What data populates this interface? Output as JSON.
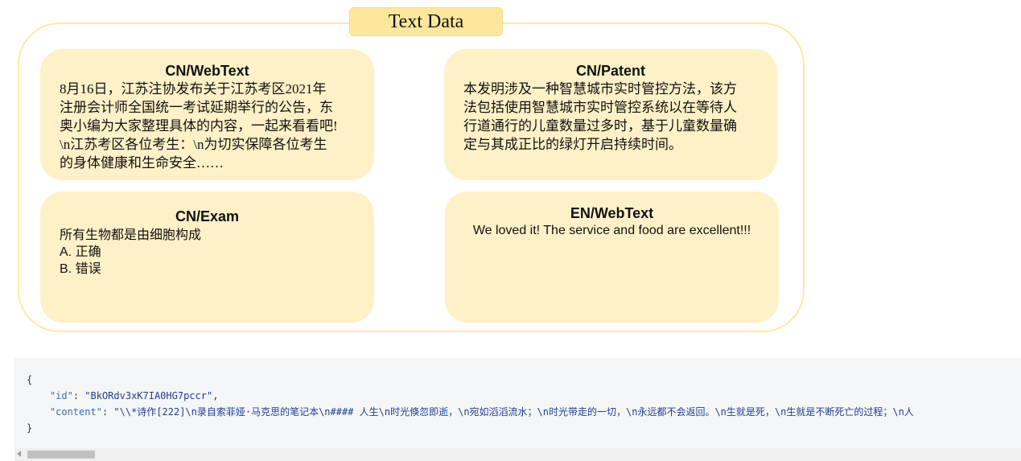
{
  "diagram": {
    "title": "Text Data",
    "cards": [
      {
        "title": "CN/WebText",
        "body": "8月16日，江苏注协发布关于江苏考区2021年\n注册会计师全国统一考试延期举行的公告，东\n奥小编为大家整理具体的内容，一起来看看吧!\n\\n江苏考区各位考生：\\n为切实保障各位考生\n的身体健康和生命安全……"
      },
      {
        "title": "CN/Patent",
        "body": "本发明涉及一种智慧城市实时管控方法，该方\n法包括使用智慧城市实时管控系统以在等待人\n行道通行的儿童数量过多时，基于儿童数量确\n定与其成正比的绿灯开启持续时间。"
      },
      {
        "title": "CN/Exam",
        "body": "所有生物都是由细胞构成\nA. 正确\nB. 错误"
      },
      {
        "title": "EN/WebText",
        "body": "We loved it! The service and food are excellent!!!"
      }
    ]
  },
  "code": {
    "open_brace": "{",
    "id_key": "\"id\"",
    "id_value": "\"BkORdv3xK7IA0HG7pccr\"",
    "content_key": "\"content\"",
    "content_value": "\"\\\\*诗作[222]\\n录自索菲娅·马克思的笔记本\\n#### 人生\\n时光倏忽即逝，\\n宛如滔滔流水；\\n时光带走的一切，\\n永远都不会返回。\\n生就是死，\\n生就是不断死亡的过程；\\n人",
    "close_brace": "}"
  }
}
